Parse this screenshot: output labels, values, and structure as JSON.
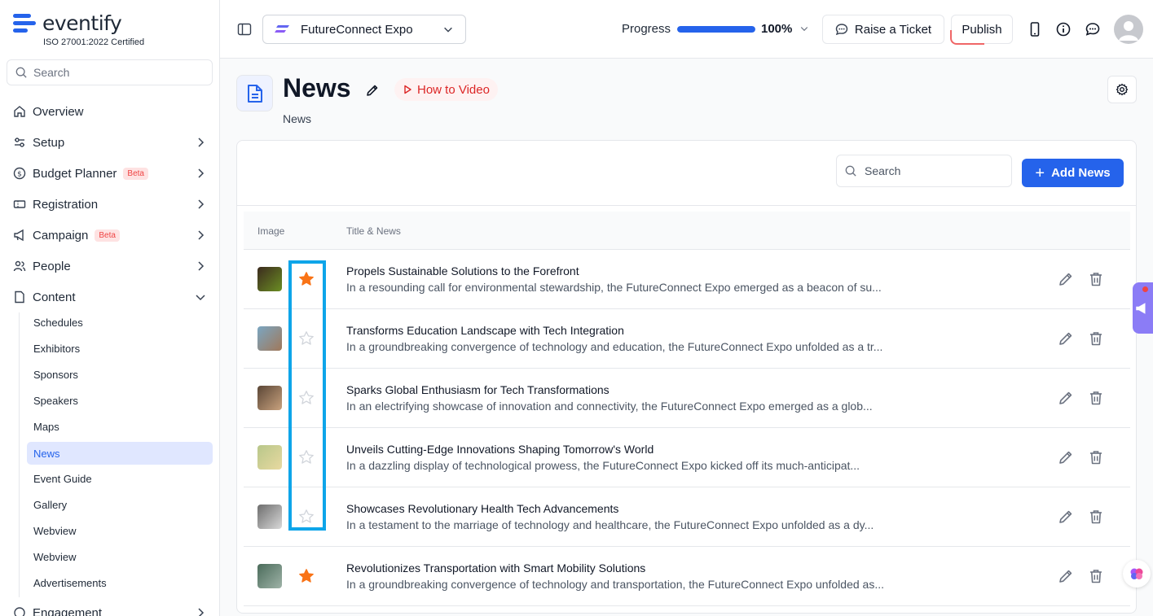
{
  "brand": {
    "name": "eventify",
    "certification": "ISO 27001:2022 Certified"
  },
  "sidebar": {
    "search_placeholder": "Search",
    "items": [
      {
        "label": "Overview"
      },
      {
        "label": "Setup"
      },
      {
        "label": "Budget Planner",
        "badge": "Beta"
      },
      {
        "label": "Registration"
      },
      {
        "label": "Campaign",
        "badge": "Beta"
      },
      {
        "label": "People"
      },
      {
        "label": "Content"
      },
      {
        "label": "Engagement"
      }
    ],
    "content_subitems": [
      {
        "label": "Schedules"
      },
      {
        "label": "Exhibitors"
      },
      {
        "label": "Sponsors"
      },
      {
        "label": "Speakers"
      },
      {
        "label": "Maps"
      },
      {
        "label": "News"
      },
      {
        "label": "Event Guide"
      },
      {
        "label": "Gallery"
      },
      {
        "label": "Webview"
      },
      {
        "label": "Webview"
      },
      {
        "label": "Advertisements"
      }
    ],
    "active_subitem": "News"
  },
  "topbar": {
    "event_name": "FutureConnect Expo",
    "progress_label": "Progress",
    "progress_value": "100%",
    "progress_fraction": 1.0,
    "ticket_label": "Raise a Ticket",
    "publish_label": "Publish"
  },
  "page": {
    "title": "News",
    "howto_label": "How to Video",
    "subtitle": "News"
  },
  "card": {
    "search_placeholder": "Search",
    "add_label": "Add News",
    "columns": {
      "image": "Image",
      "title": "Title & News"
    },
    "rows": [
      {
        "title": "Propels Sustainable Solutions to the Forefront",
        "desc": "In a resounding call for environmental stewardship, the FutureConnect Expo emerged as a beacon of su...",
        "featured": true
      },
      {
        "title": "Transforms Education Landscape with Tech Integration",
        "desc": "In a groundbreaking convergence of technology and education, the FutureConnect Expo unfolded as a tr...",
        "featured": false
      },
      {
        "title": "Sparks Global Enthusiasm for Tech Transformations",
        "desc": "In an electrifying showcase of innovation and connectivity, the FutureConnect Expo emerged as a glob...",
        "featured": false
      },
      {
        "title": "Unveils Cutting-Edge Innovations Shaping Tomorrow's World",
        "desc": "In a dazzling display of technological prowess, the FutureConnect Expo kicked off its much-anticipat...",
        "featured": false
      },
      {
        "title": "Showcases Revolutionary Health Tech Advancements",
        "desc": "In a testament to the marriage of technology and healthcare, the FutureConnect Expo unfolded as a dy...",
        "featured": false
      },
      {
        "title": "Revolutionizes Transportation with Smart Mobility Solutions",
        "desc": "In a groundbreaking convergence of technology and transportation, the FutureConnect Expo unfolded as...",
        "featured": true
      }
    ]
  },
  "colors": {
    "accent": "#2563eb",
    "star_on": "#f97316",
    "highlight": "#0ea5e9"
  }
}
